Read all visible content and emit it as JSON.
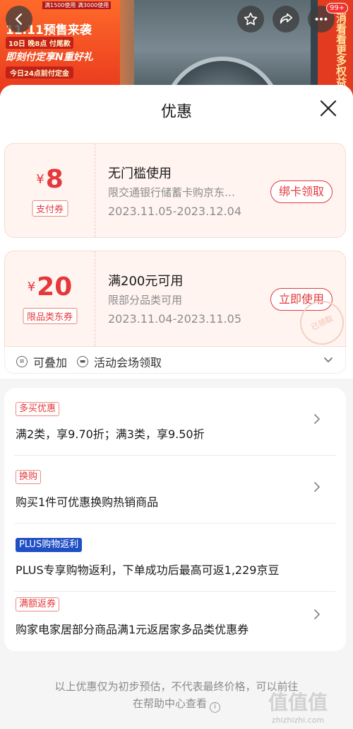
{
  "banner": {
    "promo_top": "满1500使用 满3000使用",
    "promo_line1": "11.11预售来袭",
    "promo_line2": "10日 晚8点 付尾款",
    "promo_line3": "即刻付定享N重好礼",
    "promo_line4": "今日24点前付定金",
    "side_text": "消看看更多权益",
    "notification_badge": "99+"
  },
  "sheet": {
    "title": "优惠"
  },
  "coupons": [
    {
      "currency": "¥",
      "amount": "8",
      "type_tag": "支付券",
      "title": "无门槛使用",
      "desc": "限交通银行储蓄卡购京东…",
      "date": "2023.11.05-2023.12.04",
      "action": "绑卡领取"
    },
    {
      "currency": "¥",
      "amount": "20",
      "type_tag": "限品类东券",
      "title": "满200元可用",
      "desc": "限部分品类可用",
      "date": "2023.11.04-2023.11.05",
      "action": "立即使用",
      "stamp": "已领取"
    }
  ],
  "coupon_footer": {
    "stackable": "可叠加",
    "venue": "活动会场领取"
  },
  "promotions": [
    {
      "tag": "多买优惠",
      "text": "满2类，享9.70折；满3类，享9.50折"
    },
    {
      "tag": "换购",
      "text": "购买1件可优惠换购热销商品"
    },
    {
      "tag": "PLUS购物返利",
      "text": "PLUS专享购物返利，下单成功后最高可返1,229京豆"
    },
    {
      "tag": "满额返券",
      "text": "购家电家居部分商品满1元返居家多品类优惠券"
    }
  ],
  "note": {
    "line1": "以上优惠仅为初步预估，不代表最终价格，可以前往",
    "line2": "在帮助中心查看"
  },
  "watermark": {
    "logo": "值值值",
    "url": "zhizhizhi.com"
  },
  "colors": {
    "accent_red": "#e4393c",
    "plus_blue": "#1f4fc4",
    "coupon_bg": "#fff4f0"
  }
}
